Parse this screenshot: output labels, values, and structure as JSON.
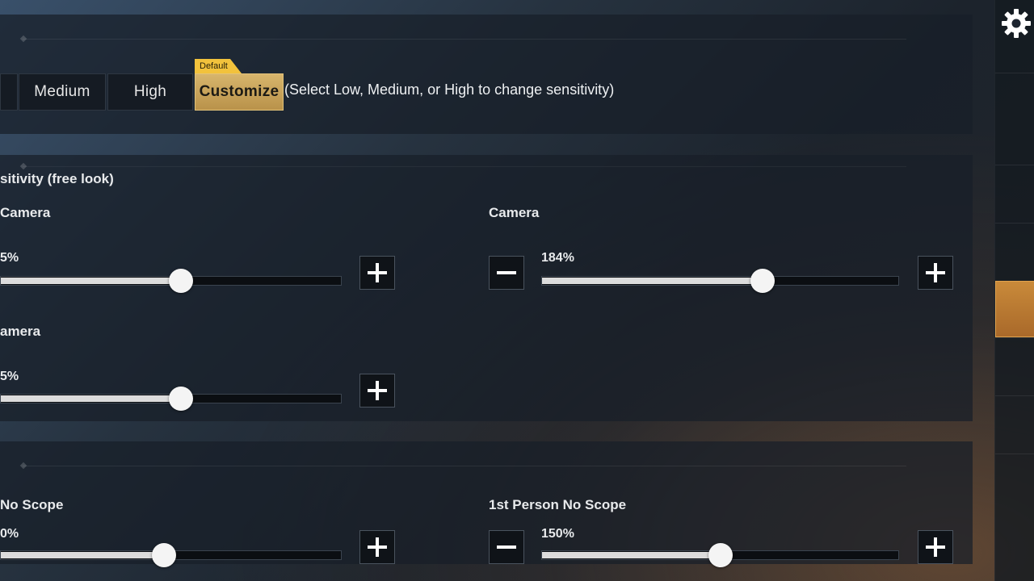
{
  "presets": {
    "default_tag": "Default",
    "low_label": "",
    "medium_label": "Medium",
    "high_label": "High",
    "customize_label": "Customize",
    "hint": "(Select Low, Medium, or High to change sensitivity)",
    "selected": "Customize"
  },
  "camera_section": {
    "title": "sitivity (free look)",
    "left_camera": {
      "label": "Camera",
      "value_text": "5%",
      "level": 0.53
    },
    "right_camera": {
      "label": "Camera",
      "value_text": "184%",
      "level": 0.62
    },
    "left_camera_2": {
      "label": "amera",
      "value_text": "5%",
      "level": 0.53
    }
  },
  "scope_section": {
    "left": {
      "label": "No Scope",
      "value_text": "0%",
      "level": 0.48
    },
    "right": {
      "label": "1st Person No Scope",
      "value_text": "150%",
      "level": 0.5
    }
  },
  "colors": {
    "accent_gold": "#d7b56c",
    "default_tag_yellow": "#f2c23c",
    "active_tab_orange": "#c98a3a"
  },
  "icons": {
    "settings": "gear-icon",
    "increase": "plus-icon",
    "decrease": "minus-icon"
  }
}
